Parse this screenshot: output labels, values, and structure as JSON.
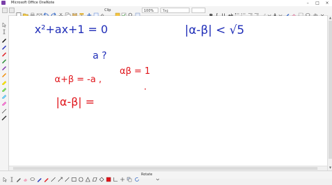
{
  "window": {
    "title": "Microsoft Office OneNote"
  },
  "toolbar": {
    "clip_label": "Clip",
    "font_value": "Tag",
    "zoom_value": "100%"
  },
  "bottombar": {
    "rotate_label": "Rotate"
  },
  "notes": {
    "eq1": "x²+ax+1 = 0",
    "ineq": "|α-β| < √5",
    "q": "a ?",
    "sum": "α+β = -a ,",
    "prod": "αβ = 1",
    "abs": "|α-β| ="
  },
  "colors": {
    "blue_ink": "#1f2db8",
    "red_ink": "#e0161c",
    "accent": "#2b6bd6"
  }
}
